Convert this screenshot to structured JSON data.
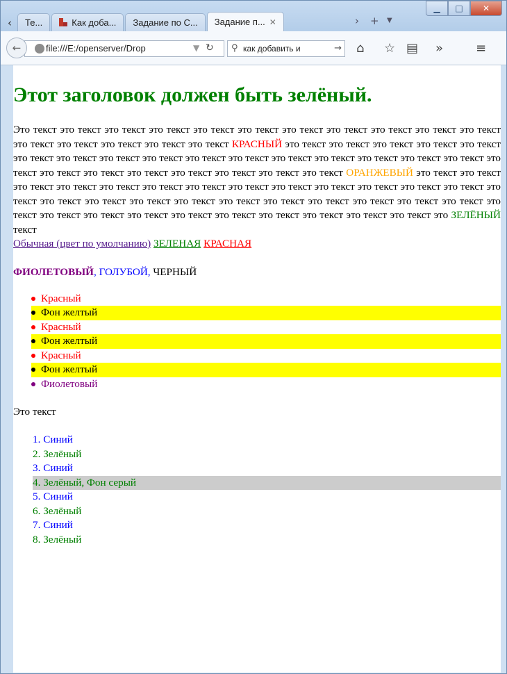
{
  "browser": {
    "tabs": [
      {
        "label": "Те..."
      },
      {
        "label": "Как доба..."
      },
      {
        "label": "Задание по С..."
      },
      {
        "label": "Задание п..."
      }
    ],
    "url": "file:///E:/openserver/Drop",
    "search_text": "как добавить и"
  },
  "page": {
    "heading": "Этот заголовок должен быть зелёный.",
    "para": {
      "part1": "Это текст это текст это текст это текст это текст это текст это текст это текст это текст это текст это текст это текст это текст это текст это текст это текст",
      "red_word": "КРАСНЫЙ",
      "part2": "это текст это текст это текст это текст это текст это текст это текст это текст это текст это текст это текст это текст это текст это текст это текст это текст это текст это текст это текст это текст это текст это текст это текст это текст",
      "orange_word": "ОРАНЖЕВЫЙ",
      "part3": "это текст это текст это текст это текст это текст это текст это текст это текст это текст это текст это текст это текст это текст это текст это текст это текст это текст это текст это текст это текст это текст это текст это текст это текст это текст это текст это текст это текст это текст это текст это текст это текст это текст это текст это",
      "green_word": "ЗЕЛЁНЫЙ",
      "part4": "текст"
    },
    "links": {
      "default": "Обычная (цвет по умолчанию)",
      "green": "ЗЕЛЕНАЯ",
      "red": "КРАСНАЯ"
    },
    "colors_line": {
      "violet": "ФИОЛЕТОВЫЙ",
      "sep1": ",",
      "blue": "ГОЛУБОЙ",
      "sep2": ",",
      "black": "ЧЕРНЫЙ"
    },
    "bullets": [
      "Красный",
      "Фон желтый",
      "Красный",
      "Фон желтый",
      "Красный",
      "Фон желтый",
      "Фиолетовый"
    ],
    "plain_text": "Это текст",
    "numbered": [
      {
        "num": "1.",
        "text": "Синий"
      },
      {
        "num": "2.",
        "text": "Зелёный"
      },
      {
        "num": "3.",
        "text": "Синий"
      },
      {
        "num": "4.",
        "text": "Зелёный, Фон серый"
      },
      {
        "num": "5.",
        "text": "Синий"
      },
      {
        "num": "6.",
        "text": "Зелёный"
      },
      {
        "num": "7.",
        "text": "Синий"
      },
      {
        "num": "8.",
        "text": "Зелёный"
      }
    ]
  }
}
